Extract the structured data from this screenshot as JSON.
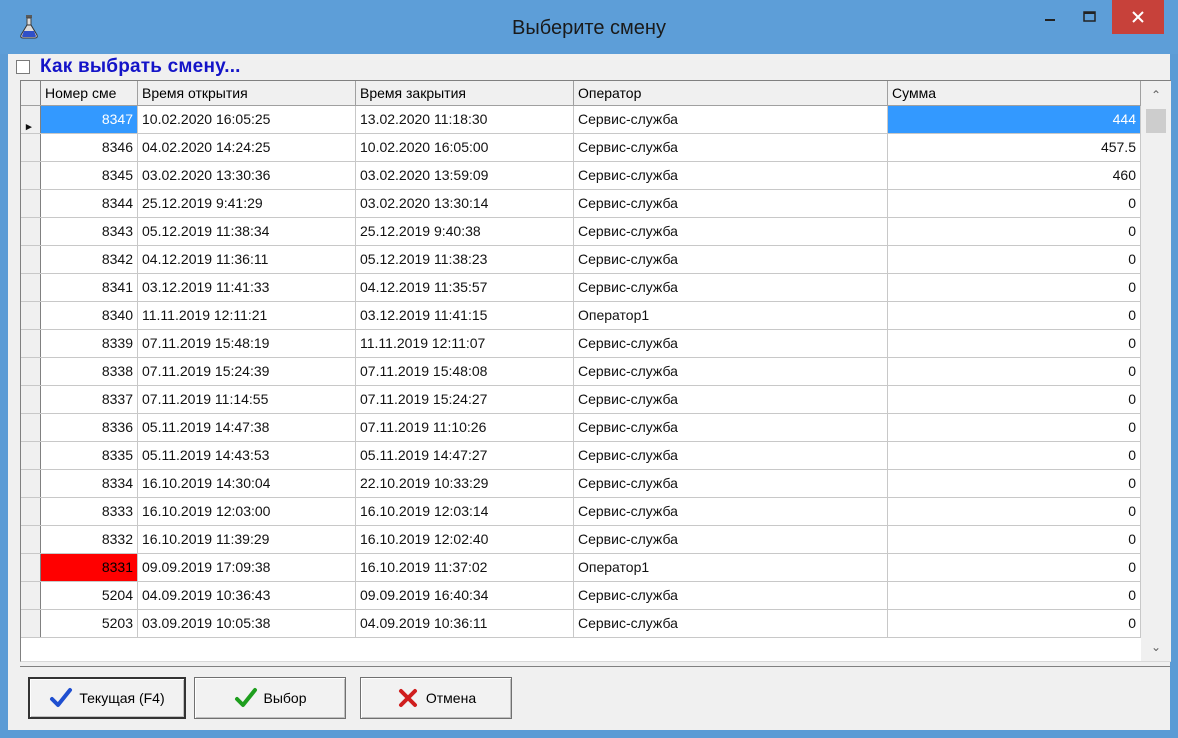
{
  "window": {
    "title": "Выберите смену"
  },
  "howto": {
    "label": "Как выбрать смену..."
  },
  "grid": {
    "columns": [
      "Номер сме",
      "Время открытия",
      "Время закрытия",
      "Оператор",
      "Сумма"
    ],
    "rows": [
      [
        "8347",
        "10.02.2020 16:05:25",
        "13.02.2020 11:18:30",
        "Сервис-служба",
        "444"
      ],
      [
        "8346",
        "04.02.2020 14:24:25",
        "10.02.2020 16:05:00",
        "Сервис-служба",
        "457.5"
      ],
      [
        "8345",
        "03.02.2020 13:30:36",
        "03.02.2020 13:59:09",
        "Сервис-служба",
        "460"
      ],
      [
        "8344",
        "25.12.2019 9:41:29",
        "03.02.2020 13:30:14",
        "Сервис-служба",
        "0"
      ],
      [
        "8343",
        "05.12.2019 11:38:34",
        "25.12.2019 9:40:38",
        "Сервис-служба",
        "0"
      ],
      [
        "8342",
        "04.12.2019 11:36:11",
        "05.12.2019 11:38:23",
        "Сервис-служба",
        "0"
      ],
      [
        "8341",
        "03.12.2019 11:41:33",
        "04.12.2019 11:35:57",
        "Сервис-служба",
        "0"
      ],
      [
        "8340",
        "11.11.2019 12:11:21",
        "03.12.2019 11:41:15",
        "Оператор1",
        "0"
      ],
      [
        "8339",
        "07.11.2019 15:48:19",
        "11.11.2019 12:11:07",
        "Сервис-служба",
        "0"
      ],
      [
        "8338",
        "07.11.2019 15:24:39",
        "07.11.2019 15:48:08",
        "Сервис-служба",
        "0"
      ],
      [
        "8337",
        "07.11.2019 11:14:55",
        "07.11.2019 15:24:27",
        "Сервис-служба",
        "0"
      ],
      [
        "8336",
        "05.11.2019 14:47:38",
        "07.11.2019 11:10:26",
        "Сервис-служба",
        "0"
      ],
      [
        "8335",
        "05.11.2019 14:43:53",
        "05.11.2019 14:47:27",
        "Сервис-служба",
        "0"
      ],
      [
        "8334",
        "16.10.2019 14:30:04",
        "22.10.2019 10:33:29",
        "Сервис-служба",
        "0"
      ],
      [
        "8333",
        "16.10.2019 12:03:00",
        "16.10.2019 12:03:14",
        "Сервис-служба",
        "0"
      ],
      [
        "8332",
        "16.10.2019 11:39:29",
        "16.10.2019 12:02:40",
        "Сервис-служба",
        "0"
      ],
      [
        "8331",
        "09.09.2019 17:09:38",
        "16.10.2019 11:37:02",
        "Оператор1",
        "0"
      ],
      [
        "5204",
        "04.09.2019 10:36:43",
        "09.09.2019 16:40:34",
        "Сервис-служба",
        "0"
      ],
      [
        "5203",
        "03.09.2019 10:05:38",
        "04.09.2019 10:36:11",
        "Сервис-служба",
        "0"
      ]
    ],
    "selected_row": 0,
    "highlight_row": 16,
    "highlight_color": "#ff0000",
    "selection_color": "#3399ff"
  },
  "buttons": {
    "current": "Текущая (F4)",
    "select": "Выбор",
    "cancel": "Отмена"
  },
  "icons": {
    "app": "flask-icon",
    "current": "checkmark-icon",
    "select": "checkmark-icon",
    "cancel": "cross-icon"
  },
  "colors": {
    "titlebar": "#5d9ed8",
    "close": "#c7413a",
    "link": "#1414c8"
  }
}
